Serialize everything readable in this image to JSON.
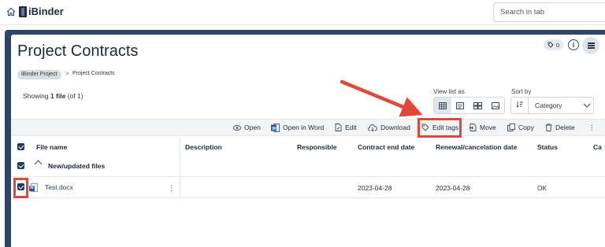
{
  "app": {
    "brand": "iBinder",
    "search_placeholder": "Search in tab"
  },
  "page": {
    "title": "Project Contracts",
    "tag_count": "0",
    "info_symbol": "i"
  },
  "breadcrumb": {
    "items": [
      "iBinder Project",
      "Project Contracts"
    ],
    "separator": ">"
  },
  "summary": {
    "prefix": "Showing ",
    "count": "1 file",
    "suffix": " (of 1)"
  },
  "view_list": {
    "label": "View list as",
    "options": [
      "table-view",
      "list-view",
      "grid-view",
      "image-view"
    ],
    "selected": "table-view"
  },
  "sort": {
    "label": "Sort by",
    "value": "Category"
  },
  "toolbar": {
    "open": "Open",
    "open_in_word": "Open in Word",
    "edit": "Edit",
    "download": "Download",
    "edit_tags": "Edit tags",
    "move": "Move",
    "copy": "Copy",
    "delete": "Delete",
    "more": "⋮"
  },
  "table": {
    "columns": [
      "File name",
      "Description",
      "Responsible",
      "Contract end date",
      "Renewal/cancelation date",
      "Status",
      "Ca"
    ],
    "group": "New/updated files",
    "rows": [
      {
        "file_name": "Test.docx",
        "description": "",
        "responsible": "",
        "contract_end_date": "2023-04-28",
        "renewal_date": "2023-04-28",
        "status": "OK"
      }
    ]
  },
  "colors": {
    "frame": "#2f4663",
    "highlight": "#e2473b",
    "checkbox": "#213a5c"
  }
}
